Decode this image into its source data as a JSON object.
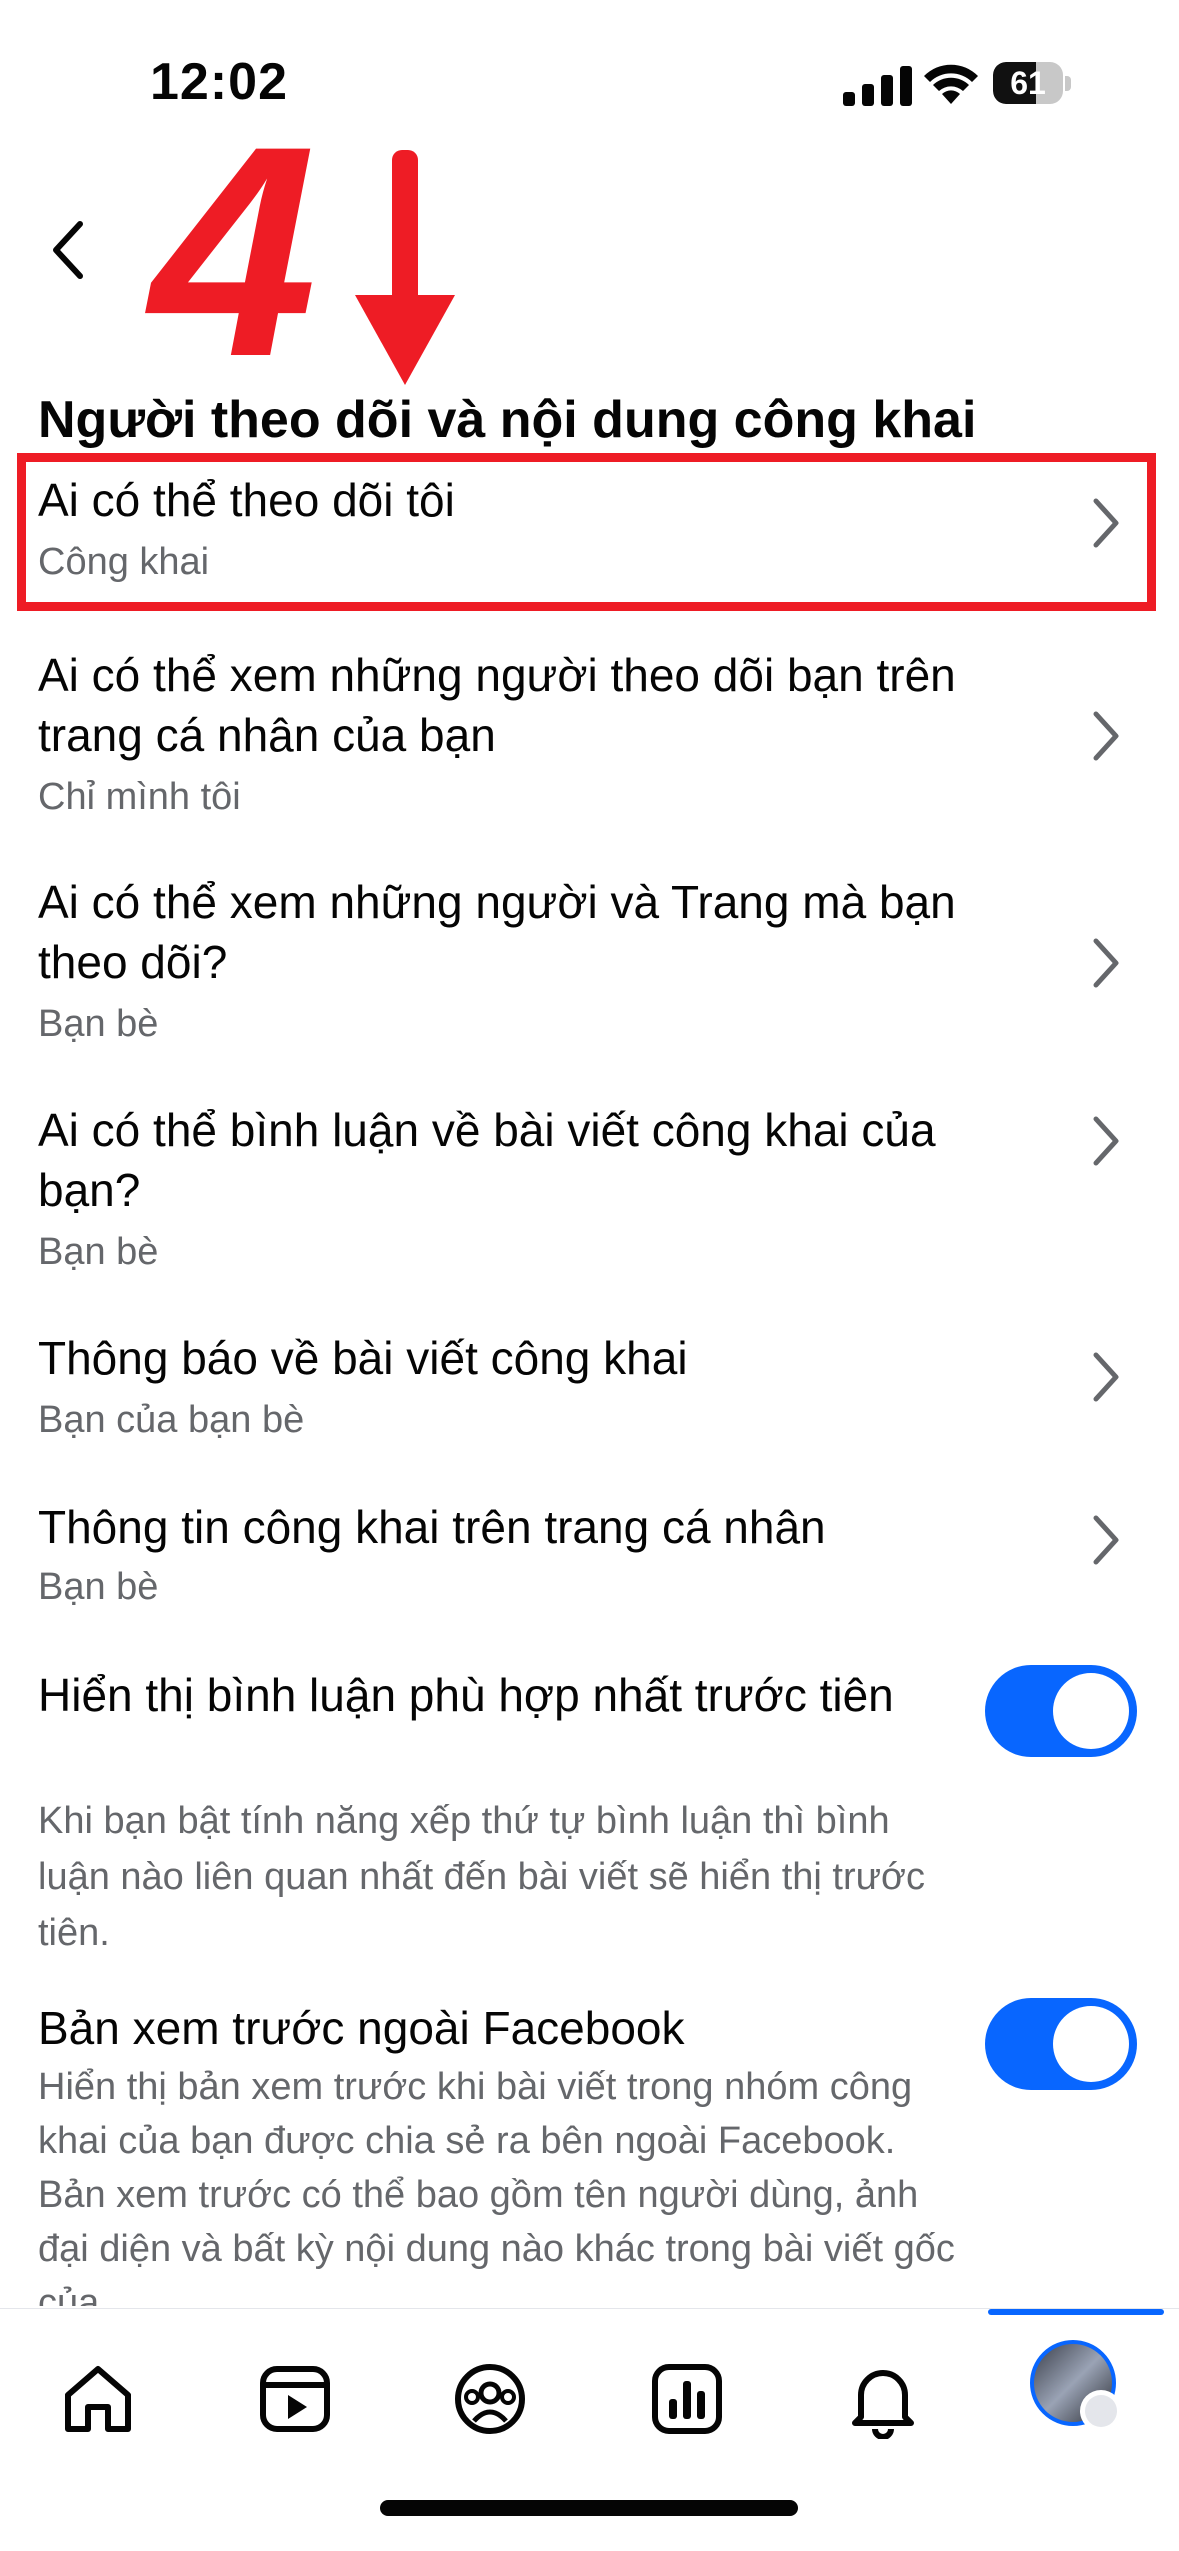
{
  "status_bar": {
    "time": "12:02",
    "battery": "61",
    "battery_level_percent": 61
  },
  "annotation": {
    "step_number": "4",
    "color": "#ee1c25"
  },
  "header": {
    "title": "Người theo dõi và nội dung công khai"
  },
  "settings": [
    {
      "title": "Ai có thể theo dõi tôi",
      "value": "Công khai"
    },
    {
      "title": "Ai có thể xem những người theo dõi bạn trên trang cá nhân của bạn",
      "value": "Chỉ mình tôi"
    },
    {
      "title": "Ai có thể xem những người và Trang mà bạn theo dõi?",
      "value": "Bạn bè"
    },
    {
      "title": "Ai có thể bình luận về bài viết công khai của bạn?",
      "value": "Bạn bè"
    },
    {
      "title": "Thông báo về bài viết công khai",
      "value": "Bạn của bạn bè"
    },
    {
      "title": "Thông tin công khai trên trang cá nhân",
      "value": "Bạn bè"
    }
  ],
  "toggles": [
    {
      "title": "Hiển thị bình luận phù hợp nhất trước tiên",
      "description": "Khi bạn bật tính năng xếp thứ tự bình luận thì bình luận nào liên quan nhất đến bài viết sẽ hiển thị trước tiên.",
      "on": true
    },
    {
      "title": "Bản xem trước ngoài Facebook",
      "description": "Hiển thị bản xem trước khi bài viết trong nhóm công khai của bạn được chia sẻ ra bên ngoài Facebook. Bản xem trước có thể bao gồm tên người dùng, ảnh đại diện và bất kỳ nội dung nào khác trong bài viết gốc của",
      "on": true
    }
  ],
  "tab_bar": {
    "tabs": [
      "home-icon",
      "video-icon",
      "groups-icon",
      "dashboard-icon",
      "notifications-icon",
      "profile-menu"
    ],
    "active": "profile-menu"
  },
  "colors": {
    "accent": "#0866ff",
    "highlight": "#ee1c25",
    "secondary_text": "#65676b"
  }
}
